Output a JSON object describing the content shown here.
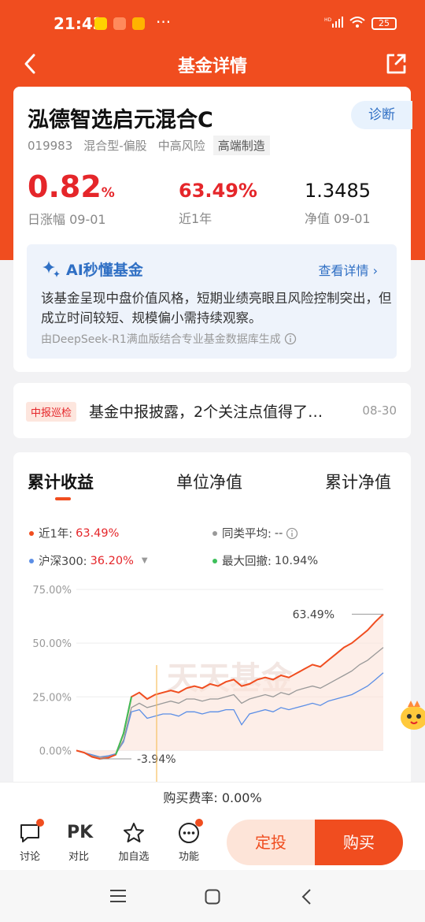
{
  "status_bar": {
    "time": "21:43",
    "battery": "25",
    "network": "HD"
  },
  "nav": {
    "title": "基金详情"
  },
  "fund": {
    "name": "泓德智选启元混合C",
    "diagnose_label": "诊断",
    "code": "019983",
    "type": "混合型-偏股",
    "risk": "中高风险",
    "theme": "高端制造",
    "daily_change_value": "0.82",
    "daily_change_unit": "%",
    "daily_change_label": "日涨幅 09-01",
    "year_return": "63.49%",
    "year_return_label": "近1年",
    "nav_value": "1.3485",
    "nav_label": "净值 09-01"
  },
  "ai": {
    "title": "AI秒懂基金",
    "more_label": "查看详情",
    "text": "该基金呈现中盘价值风格，短期业绩亮眼且风险控制突出，但成立时间较短、规模偏小需持续观察。",
    "footer": "由DeepSeek-R1满血版结合专业基金数据库生成"
  },
  "report": {
    "tag": "中报巡检",
    "text": "基金中报披露，2个关注点值得了…",
    "date": "08-30"
  },
  "chart_tabs": [
    "累计收益",
    "单位净值",
    "累计净值"
  ],
  "legend": {
    "fund_label": "近1年:",
    "fund_value": "63.49%",
    "peer_label": "同类平均:",
    "peer_value": "--",
    "index_label": "沪深300:",
    "index_value": "36.20%",
    "drawdown_label": "最大回撤:",
    "drawdown_value": "10.94%"
  },
  "colors": {
    "fund": "#f04d1f",
    "peer": "#999999",
    "index": "#5b8ee6",
    "drawdown": "#3cbf5a",
    "accent": "#f04d1f"
  },
  "chart_data": {
    "type": "line",
    "yticks": [
      "75.00%",
      "50.00%",
      "25.00%",
      "0.00%"
    ],
    "ylim": [
      -5,
      75
    ],
    "watermark": "天天基金",
    "annotations": {
      "max_label": "63.49%",
      "min_label": "-3.94%"
    },
    "series": [
      {
        "name": "近1年",
        "values": [
          0,
          -1,
          -3,
          -3.9,
          -3.5,
          -2,
          8,
          25,
          27,
          24,
          26,
          27,
          28,
          27,
          29,
          30,
          29,
          31,
          30,
          32,
          33,
          30,
          31,
          33,
          34,
          33,
          35,
          34,
          36,
          38,
          40,
          39,
          42,
          45,
          48,
          50,
          53,
          56,
          60,
          63.49
        ]
      },
      {
        "name": "同类平均",
        "values": [
          0,
          -1,
          -2.5,
          -3.2,
          -3,
          -2,
          5,
          20,
          22,
          20,
          21,
          22,
          23,
          22,
          24,
          24,
          23,
          24,
          24,
          25,
          26,
          22,
          24,
          25,
          26,
          25,
          27,
          26,
          28,
          29,
          30,
          29,
          31,
          33,
          35,
          37,
          40,
          42,
          45,
          48
        ]
      },
      {
        "name": "沪深300",
        "values": [
          0,
          -1,
          -2,
          -3,
          -2.5,
          -1.5,
          4,
          18,
          19,
          15,
          16,
          17,
          17,
          16,
          18,
          18,
          17,
          18,
          18,
          19,
          19,
          12,
          17,
          18,
          19,
          18,
          20,
          19,
          20,
          21,
          22,
          21,
          23,
          24,
          25,
          26,
          28,
          30,
          33,
          36.2
        ]
      }
    ]
  },
  "fee": {
    "label": "购买费率:",
    "value": "0.00%"
  },
  "bottom": {
    "discuss": "讨论",
    "pk": "PK",
    "compare": "对比",
    "favorite": "加自选",
    "functions": "功能",
    "sip": "定投",
    "buy": "购买"
  }
}
